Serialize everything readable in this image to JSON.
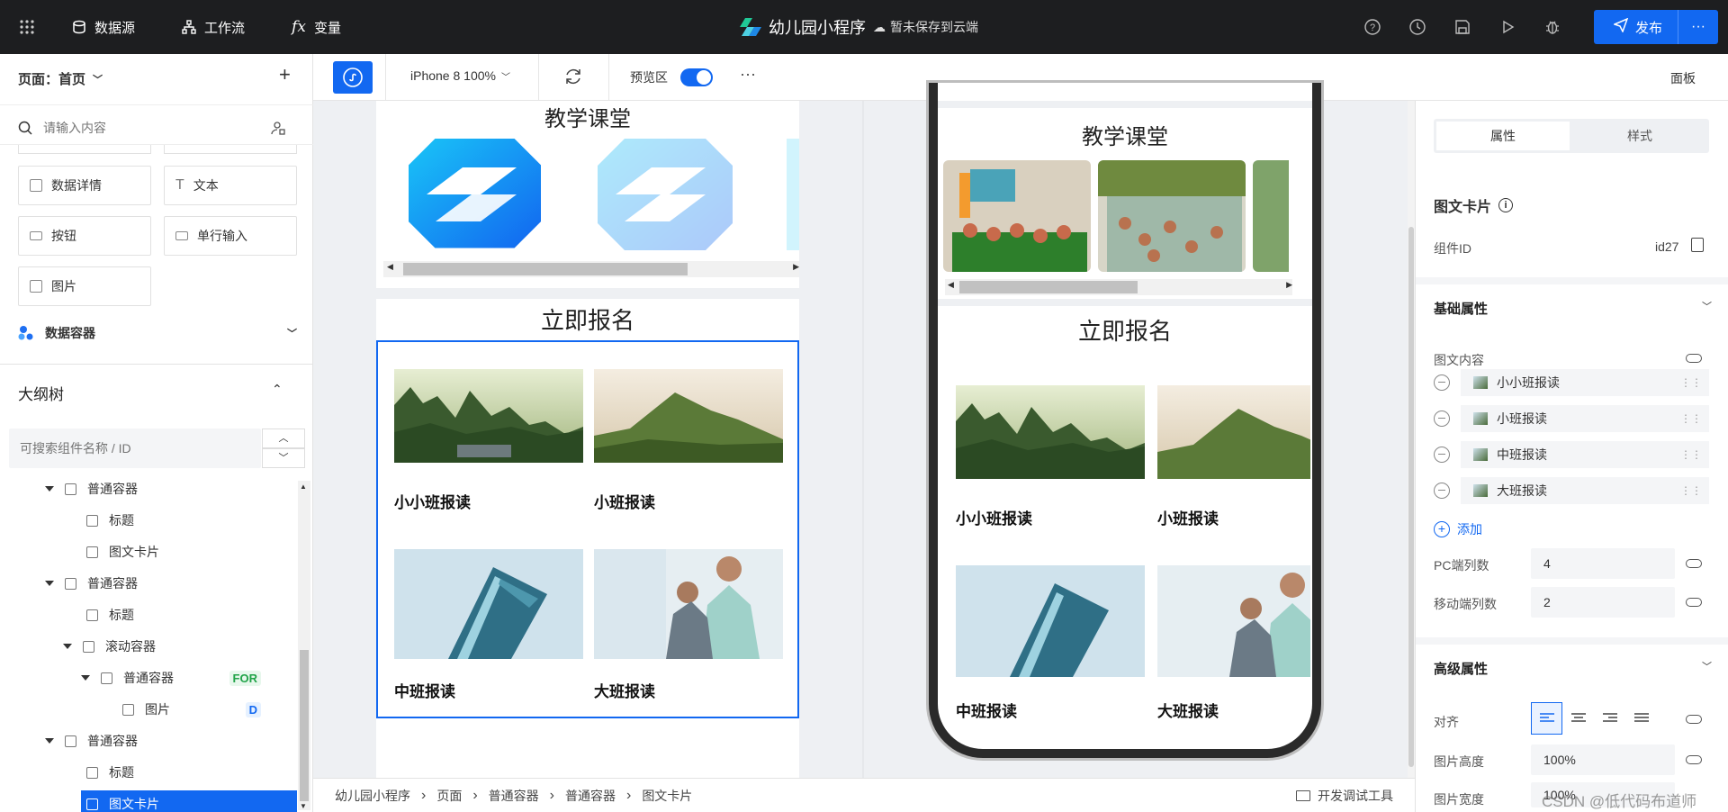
{
  "topbar": {
    "datasource": "数据源",
    "workflow": "工作流",
    "variables": "变量",
    "app_title": "幼儿园小程序",
    "save_status": "暂未保存到云端",
    "publish": "发布"
  },
  "left": {
    "page_label": "页面：首页",
    "search_placeholder": "请输入内容",
    "components": [
      "数据详情",
      "文本",
      "按钮",
      "单行输入",
      "图片"
    ],
    "data_container": "数据容器",
    "outline_title": "大纲树",
    "outline_search_placeholder": "可搜索组件名称 / ID",
    "tree": [
      {
        "label": "普通容器",
        "level": 0,
        "caret": true,
        "tag": ""
      },
      {
        "label": "标题",
        "level": 1,
        "caret": false,
        "tag": ""
      },
      {
        "label": "图文卡片",
        "level": 1,
        "caret": false,
        "tag": ""
      },
      {
        "label": "普通容器",
        "level": 0,
        "caret": true,
        "tag": ""
      },
      {
        "label": "标题",
        "level": 1,
        "caret": false,
        "tag": ""
      },
      {
        "label": "滚动容器",
        "level": 1,
        "caret": true,
        "tag": ""
      },
      {
        "label": "普通容器",
        "level": 2,
        "caret": true,
        "tag": "FOR"
      },
      {
        "label": "图片",
        "level": 3,
        "caret": false,
        "tag": "D"
      },
      {
        "label": "普通容器",
        "level": 0,
        "caret": true,
        "tag": ""
      },
      {
        "label": "标题",
        "level": 1,
        "caret": false,
        "tag": ""
      },
      {
        "label": "图文卡片",
        "level": 1,
        "caret": false,
        "tag": "",
        "selected": true
      }
    ]
  },
  "toolbar": {
    "device": "iPhone 8 100%",
    "preview": "预览区",
    "panel": "面板"
  },
  "canvas": {
    "section1": "教学课堂",
    "section2": "立即报名",
    "cards": [
      "小小班报读",
      "小班报读",
      "中班报读",
      "大班报读"
    ]
  },
  "right": {
    "tab_props": "属性",
    "tab_style": "样式",
    "component_name": "图文卡片",
    "id_label": "组件ID",
    "id_value": "id27",
    "basic": "基础属性",
    "content_label": "图文内容",
    "items": [
      "小小班报读",
      "小班报读",
      "中班报读",
      "大班报读"
    ],
    "add": "添加",
    "pc_cols_label": "PC端列数",
    "pc_cols": "4",
    "mobile_cols_label": "移动端列数",
    "mobile_cols": "2",
    "advanced": "高级属性",
    "align_label": "对齐",
    "img_height_label": "图片高度",
    "img_height": "100%",
    "img_width_label": "图片宽度",
    "img_width": "100%"
  },
  "breadcrumb": [
    "幼儿园小程序",
    "页面",
    "普通容器",
    "普通容器",
    "图文卡片"
  ],
  "devtools": "开发调试工具",
  "watermark": "CSDN @低代码布道师"
}
